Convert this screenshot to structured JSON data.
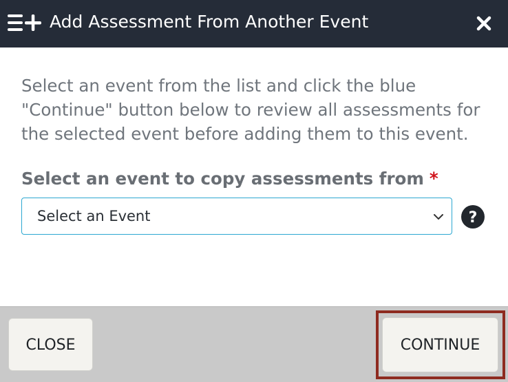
{
  "dialog": {
    "title": "Add Assessment From Another Event",
    "title_icon": "list-add-icon",
    "close_icon": "close-icon"
  },
  "body": {
    "instructions": "Select an event from the list and click the blue \"Continue\" button below to review all assessments for the selected event before adding them to this event.",
    "field_label": "Select an event to copy assessments from",
    "required_mark": "*",
    "select": {
      "selected_value": "Select an Event",
      "chevron_icon": "chevron-down-icon"
    },
    "help_icon": "question-circle-icon"
  },
  "footer": {
    "close_label": "CLOSE",
    "continue_label": "CONTINUE"
  },
  "colors": {
    "header_bg": "#252c38",
    "select_border": "#2ba7d1",
    "required": "#d0131b",
    "footer_bg": "#c9c9c9",
    "highlight": "#8e2b20"
  }
}
